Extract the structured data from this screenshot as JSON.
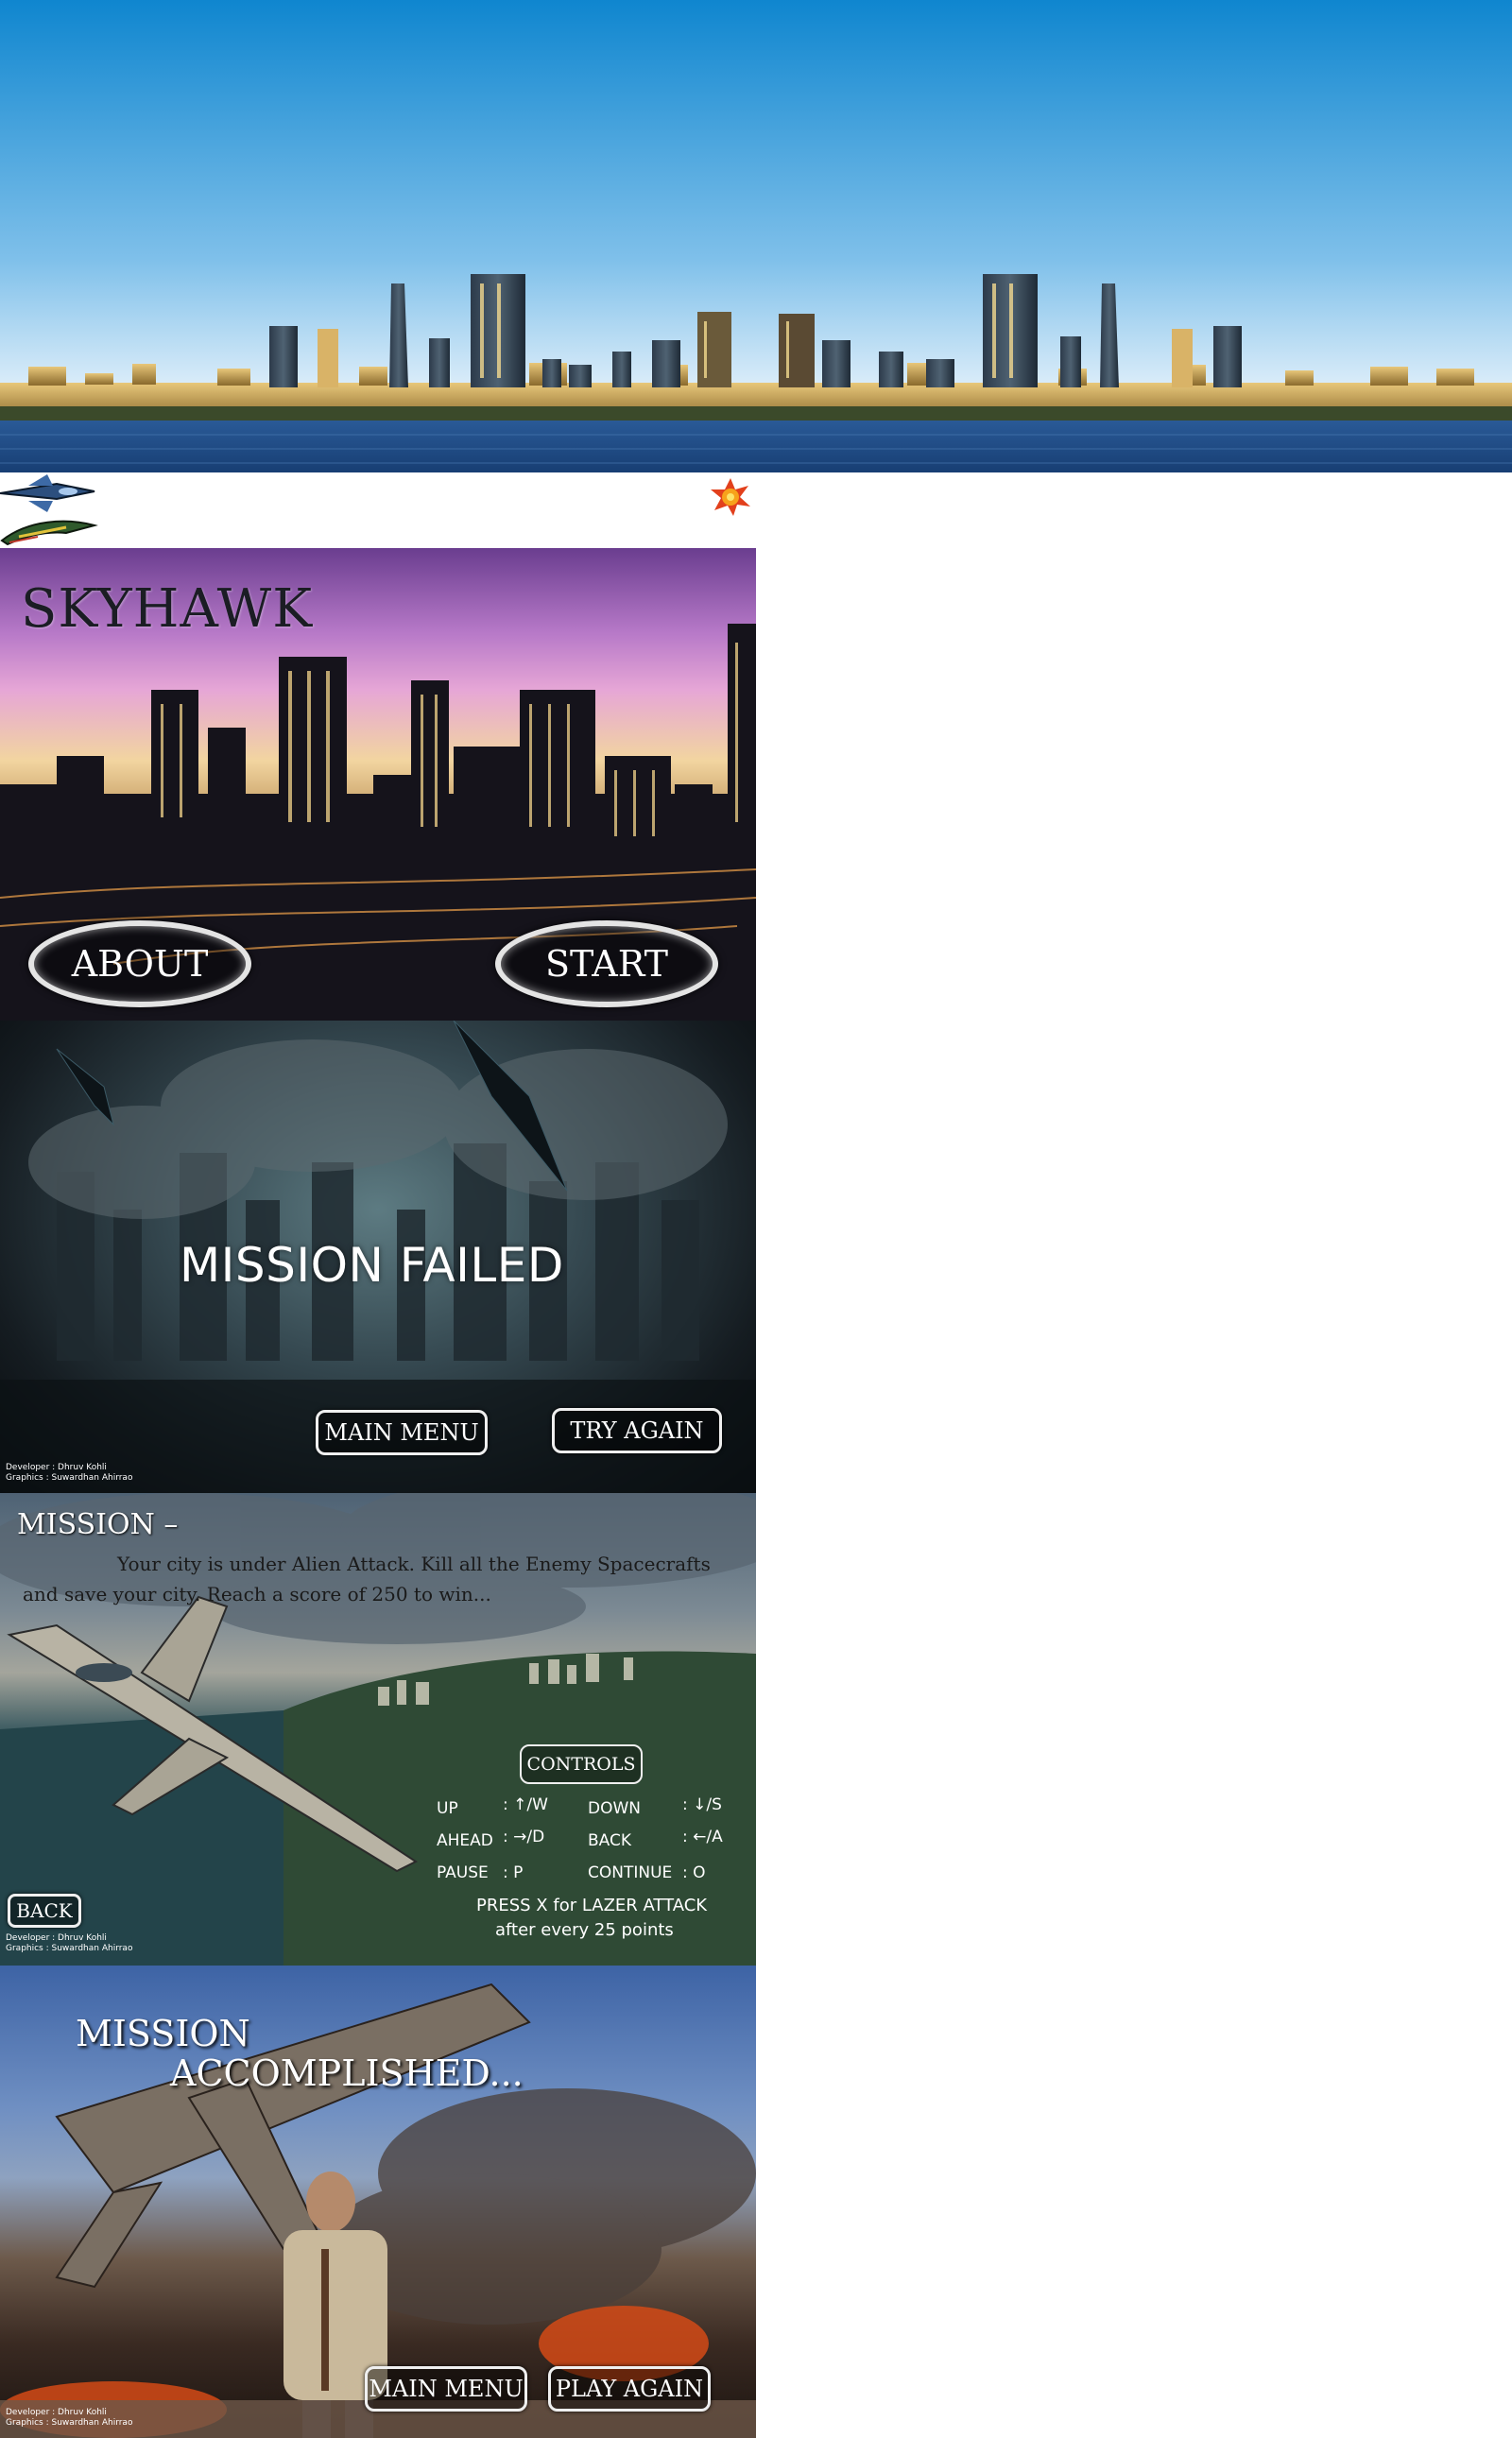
{
  "start_screen": {
    "title": "SKYHAWK",
    "about_label": "ABOUT",
    "start_label": "START"
  },
  "failed_screen": {
    "heading": "MISSION FAILED",
    "main_menu_label": "MAIN  MENU",
    "try_again_label": "TRY AGAIN",
    "credit_developer": "Developer : Dhruv Kohli",
    "credit_graphics": "Graphics    : Suwardhan Ahirrao"
  },
  "mission_screen": {
    "title": "MISSION –",
    "brief_line1": "Your city is under Alien Attack. Kill all the Enemy Spacecrafts",
    "brief_line2": "and save your city. Reach a score of 250 to win...",
    "controls_label": "CONTROLS",
    "controls": [
      {
        "name": "UP",
        "key": ": ↑/W"
      },
      {
        "name": "DOWN",
        "key": ": ↓/S"
      },
      {
        "name": "AHEAD",
        "key": ": →/D"
      },
      {
        "name": "BACK",
        "key": ": ←/A"
      },
      {
        "name": "PAUSE",
        "key": ": P"
      },
      {
        "name": "CONTINUE",
        "key": ": O"
      }
    ],
    "laser_line1": "PRESS X for LAZER ATTACK",
    "laser_line2": "after every 25 points",
    "back_label": "BACK",
    "credit_developer": "Developer : Dhruv Kohli",
    "credit_graphics": "Graphics    : Suwardhan Ahirrao"
  },
  "accomplished_screen": {
    "heading_line1": "MISSION",
    "heading_line2": "ACCOMPLISHED...",
    "main_menu_label": "MAIN MENU",
    "play_again_label": "PLAY AGAIN",
    "credit_developer": "Developer : Dhruv Kohli",
    "credit_graphics": "Graphics    : Suwardhan Ahirrao"
  },
  "colors": {
    "sky_top": "#1a8fd4",
    "sky_bottom": "#dfeefa",
    "water": "#1c4a86",
    "button_border": "#e4e4e4"
  }
}
